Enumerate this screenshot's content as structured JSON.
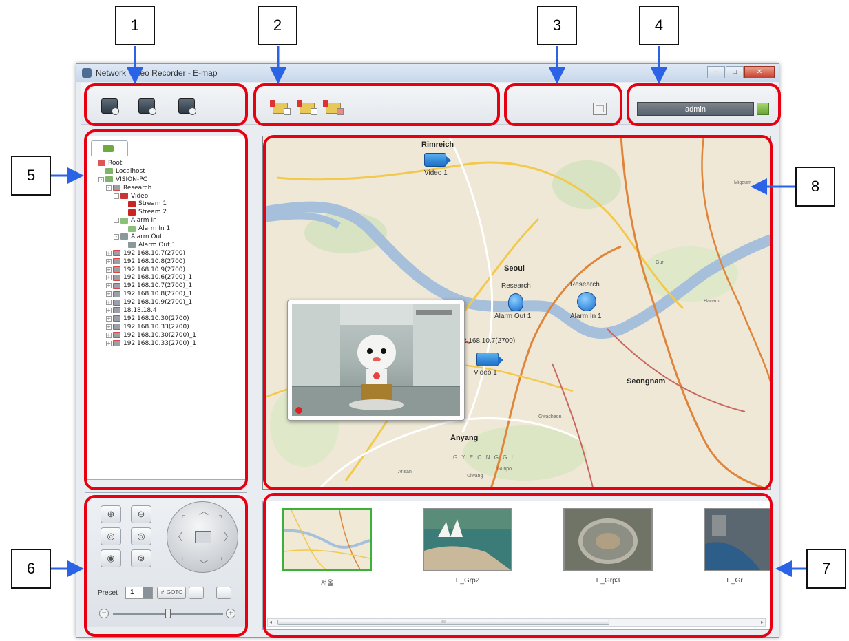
{
  "window": {
    "title": "Network Video Recorder - E-map",
    "min_label": "–",
    "max_label": "□",
    "close_label": "✕"
  },
  "callouts": [
    "1",
    "2",
    "3",
    "4",
    "5",
    "6",
    "7",
    "8"
  ],
  "toolbar": {
    "user": "admin"
  },
  "tree": {
    "nodes": [
      {
        "label": "Root",
        "depth": 0,
        "icon": "root-icon",
        "exp": ""
      },
      {
        "label": "Localhost",
        "depth": 1,
        "icon": "pc-icon",
        "exp": ""
      },
      {
        "label": "VISION-PC",
        "depth": 1,
        "icon": "pc-icon",
        "exp": "-"
      },
      {
        "label": "Research",
        "depth": 2,
        "icon": "nvr-icon",
        "exp": "-"
      },
      {
        "label": "Video",
        "depth": 3,
        "icon": "video-icon",
        "exp": "-"
      },
      {
        "label": "Stream 1",
        "depth": 4,
        "icon": "stream-icon",
        "exp": ""
      },
      {
        "label": "Stream 2",
        "depth": 4,
        "icon": "stream-icon",
        "exp": ""
      },
      {
        "label": "Alarm In",
        "depth": 3,
        "icon": "alarm-in-icon",
        "exp": "-"
      },
      {
        "label": "Alarm In 1",
        "depth": 4,
        "icon": "alarm-in-icon",
        "exp": ""
      },
      {
        "label": "Alarm Out",
        "depth": 3,
        "icon": "alarm-out-icon",
        "exp": "-"
      },
      {
        "label": "Alarm Out 1",
        "depth": 4,
        "icon": "alarm-out-icon",
        "exp": ""
      },
      {
        "label": "192.168.10.7(2700)",
        "depth": 2,
        "icon": "nvr-icon",
        "exp": "+"
      },
      {
        "label": "192.168.10.8(2700)",
        "depth": 2,
        "icon": "nvr-icon",
        "exp": "+"
      },
      {
        "label": "192.168.10.9(2700)",
        "depth": 2,
        "icon": "nvr-icon",
        "exp": "+"
      },
      {
        "label": "192.168.10.6(2700)_1",
        "depth": 2,
        "icon": "nvr-icon",
        "exp": "+"
      },
      {
        "label": "192.168.10.7(2700)_1",
        "depth": 2,
        "icon": "nvr-icon",
        "exp": "+"
      },
      {
        "label": "192.168.10.8(2700)_1",
        "depth": 2,
        "icon": "nvr-icon",
        "exp": "+"
      },
      {
        "label": "192.168.10.9(2700)_1",
        "depth": 2,
        "icon": "nvr-icon",
        "exp": "+"
      },
      {
        "label": "18.18.18.4",
        "depth": 2,
        "icon": "nvr-icon",
        "exp": "+"
      },
      {
        "label": "192.168.10.30(2700)",
        "depth": 2,
        "icon": "nvr-icon",
        "exp": "+"
      },
      {
        "label": "192.168.10.33(2700)",
        "depth": 2,
        "icon": "nvr-icon",
        "exp": "+"
      },
      {
        "label": "192.168.10.30(2700)_1",
        "depth": 2,
        "icon": "nvr-icon",
        "exp": "+"
      },
      {
        "label": "192.168.10.33(2700)_1",
        "depth": 2,
        "icon": "nvr-icon",
        "exp": "+"
      }
    ]
  },
  "ptz": {
    "preset_label": "Preset",
    "preset_value": "1",
    "goto_label": "↱ GOTO",
    "zoom_in": "+",
    "zoom_out": "−",
    "zoom_level": 0.5
  },
  "map": {
    "places": {
      "rimreich": "Rimreich",
      "seoul": "Seoul",
      "seongnam": "Seongnam",
      "anyang": "Anyang",
      "hanam": "Hanam",
      "guri": "Guri",
      "migeum": "Migeum",
      "ansan": "Ansan",
      "uiwang": "Uiwang",
      "gwacheon": "Gwacheon",
      "gunpo": "Gunpo",
      "gyeonggi": "G Y E O N G G I"
    },
    "markers": {
      "video1_top": "Video 1",
      "video1_bottom": "Video 1",
      "research_1": "Research",
      "research_2": "Research",
      "alarm_out": "Alarm Out 1",
      "alarm_in": "Alarm In 1",
      "ip_label": "2.168.10.7(2700)"
    }
  },
  "thumbnails": [
    {
      "label": "서울",
      "selected": true
    },
    {
      "label": "E_Grp2",
      "selected": false
    },
    {
      "label": "E_Grp3",
      "selected": false
    },
    {
      "label": "E_Gr",
      "selected": false
    }
  ],
  "scrollbar_grip": "III"
}
